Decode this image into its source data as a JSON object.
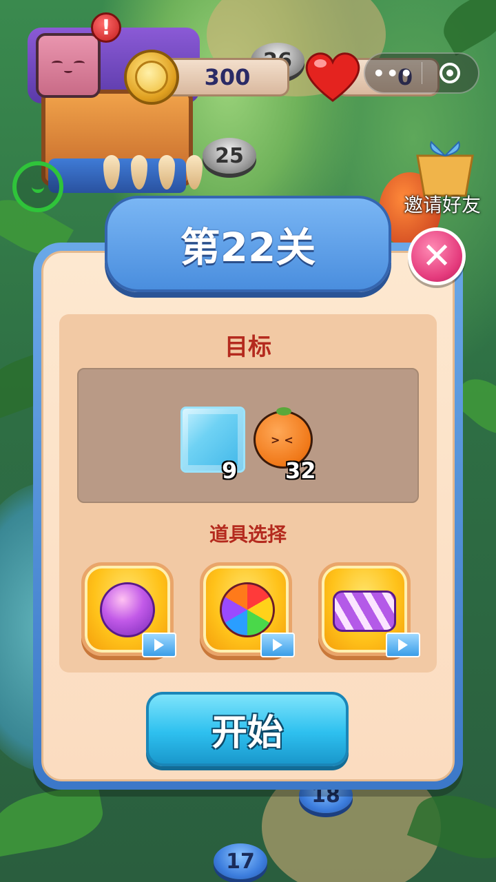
{
  "top_bar": {
    "coins": "300",
    "lives": "0",
    "capsule_menu": "•••"
  },
  "map": {
    "level_nodes": [
      "26",
      "25",
      "18",
      "17"
    ]
  },
  "invite": {
    "label": "邀请好友"
  },
  "dialog": {
    "title": "第22关",
    "goal_heading": "目标",
    "goals": [
      {
        "icon": "ice-block-icon",
        "count": "9"
      },
      {
        "icon": "orange-fruit-icon",
        "count": "32"
      }
    ],
    "tools_heading": "道具选择",
    "tools": [
      {
        "icon": "swirl-ball-booster-icon"
      },
      {
        "icon": "rainbow-ball-booster-icon"
      },
      {
        "icon": "striped-candy-booster-icon"
      }
    ],
    "start_label": "开始",
    "close_symbol": "✕"
  },
  "colors": {
    "dialog_frame": "#4a8ede",
    "panel_bg": "#fbdcc0",
    "heading_red": "#b42a1e",
    "start_button": "#2ec0ef",
    "close_button": "#e43a7c"
  }
}
